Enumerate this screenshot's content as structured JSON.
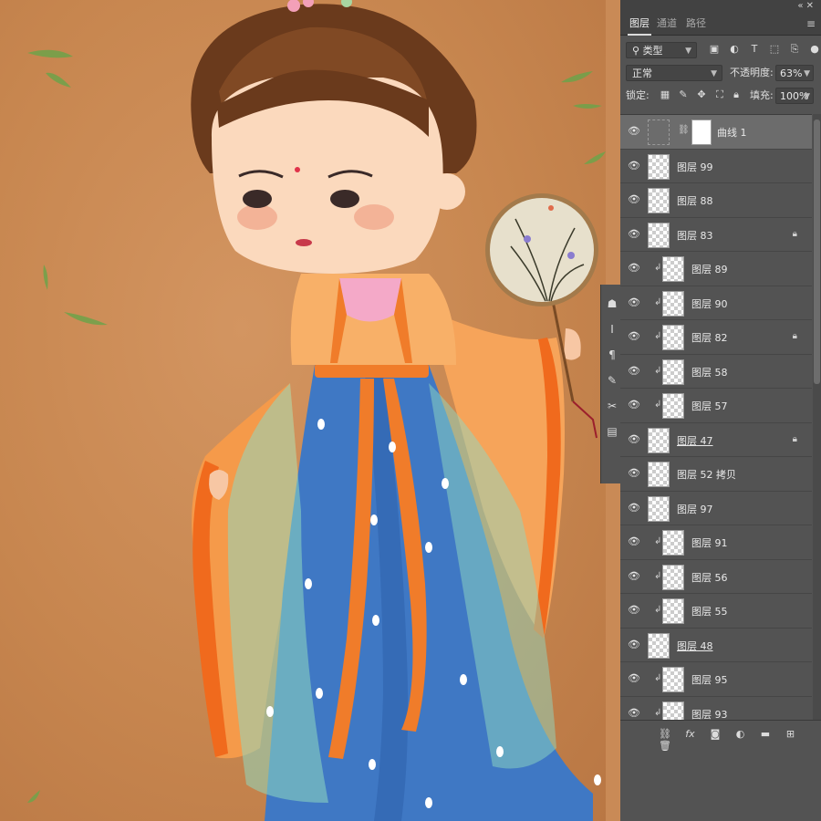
{
  "panel": {
    "tabs": [
      "图层",
      "通道",
      "路径"
    ],
    "filter": {
      "label": "类型"
    },
    "blend_mode": "正常",
    "opacity_label": "不透明度:",
    "opacity_value": "63%",
    "lock_label": "锁定:",
    "fill_label": "填充:",
    "fill_value": "100%",
    "layers": [
      {
        "name": "曲线 1",
        "type": "adjustment",
        "selected": true
      },
      {
        "name": "图层 99"
      },
      {
        "name": "图层 88"
      },
      {
        "name": "图层 83",
        "locked": true
      },
      {
        "name": "图层 89",
        "clipped": true
      },
      {
        "name": "图层 90",
        "clipped": true
      },
      {
        "name": "图层 82",
        "clipped": true,
        "locked": true
      },
      {
        "name": "图层 58",
        "clipped": true
      },
      {
        "name": "图层 57",
        "clipped": true
      },
      {
        "name": "图层 47",
        "locked": true,
        "underline": true
      },
      {
        "name": "图层 52 拷贝"
      },
      {
        "name": "图层 97"
      },
      {
        "name": "图层 91",
        "clipped": true
      },
      {
        "name": "图层 56",
        "clipped": true
      },
      {
        "name": "图层 55",
        "clipped": true
      },
      {
        "name": "图层 48",
        "underline": true
      },
      {
        "name": "图层 95",
        "clipped": true
      },
      {
        "name": "图层 93",
        "clipped": true
      }
    ]
  },
  "icons": {
    "eye": "eye-icon",
    "lock": "lock-icon",
    "link": "chain-link-icon",
    "clip": "clipping-arrow-icon"
  },
  "colors": {
    "canvas_bg": "#c98a56",
    "panel_bg": "#535353",
    "robe_blue": "#3f78c4",
    "robe_orange": "#f07c2a",
    "sheer_green": "#8fd8c0"
  }
}
